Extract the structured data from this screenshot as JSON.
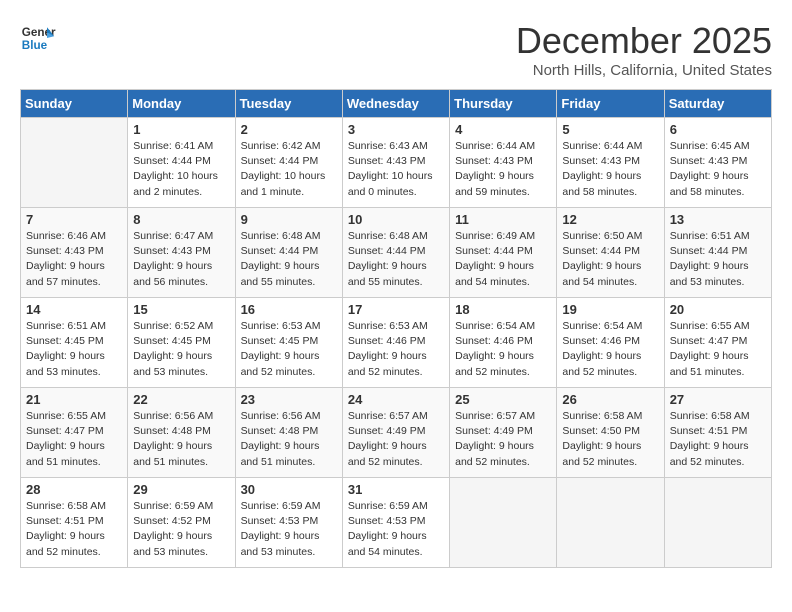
{
  "logo": {
    "line1": "General",
    "line2": "Blue"
  },
  "title": "December 2025",
  "subtitle": "North Hills, California, United States",
  "days_of_week": [
    "Sunday",
    "Monday",
    "Tuesday",
    "Wednesday",
    "Thursday",
    "Friday",
    "Saturday"
  ],
  "weeks": [
    [
      {
        "day": "",
        "info": ""
      },
      {
        "day": "1",
        "info": "Sunrise: 6:41 AM\nSunset: 4:44 PM\nDaylight: 10 hours\nand 2 minutes."
      },
      {
        "day": "2",
        "info": "Sunrise: 6:42 AM\nSunset: 4:44 PM\nDaylight: 10 hours\nand 1 minute."
      },
      {
        "day": "3",
        "info": "Sunrise: 6:43 AM\nSunset: 4:43 PM\nDaylight: 10 hours\nand 0 minutes."
      },
      {
        "day": "4",
        "info": "Sunrise: 6:44 AM\nSunset: 4:43 PM\nDaylight: 9 hours\nand 59 minutes."
      },
      {
        "day": "5",
        "info": "Sunrise: 6:44 AM\nSunset: 4:43 PM\nDaylight: 9 hours\nand 58 minutes."
      },
      {
        "day": "6",
        "info": "Sunrise: 6:45 AM\nSunset: 4:43 PM\nDaylight: 9 hours\nand 58 minutes."
      }
    ],
    [
      {
        "day": "7",
        "info": "Sunrise: 6:46 AM\nSunset: 4:43 PM\nDaylight: 9 hours\nand 57 minutes."
      },
      {
        "day": "8",
        "info": "Sunrise: 6:47 AM\nSunset: 4:43 PM\nDaylight: 9 hours\nand 56 minutes."
      },
      {
        "day": "9",
        "info": "Sunrise: 6:48 AM\nSunset: 4:44 PM\nDaylight: 9 hours\nand 55 minutes."
      },
      {
        "day": "10",
        "info": "Sunrise: 6:48 AM\nSunset: 4:44 PM\nDaylight: 9 hours\nand 55 minutes."
      },
      {
        "day": "11",
        "info": "Sunrise: 6:49 AM\nSunset: 4:44 PM\nDaylight: 9 hours\nand 54 minutes."
      },
      {
        "day": "12",
        "info": "Sunrise: 6:50 AM\nSunset: 4:44 PM\nDaylight: 9 hours\nand 54 minutes."
      },
      {
        "day": "13",
        "info": "Sunrise: 6:51 AM\nSunset: 4:44 PM\nDaylight: 9 hours\nand 53 minutes."
      }
    ],
    [
      {
        "day": "14",
        "info": "Sunrise: 6:51 AM\nSunset: 4:45 PM\nDaylight: 9 hours\nand 53 minutes."
      },
      {
        "day": "15",
        "info": "Sunrise: 6:52 AM\nSunset: 4:45 PM\nDaylight: 9 hours\nand 53 minutes."
      },
      {
        "day": "16",
        "info": "Sunrise: 6:53 AM\nSunset: 4:45 PM\nDaylight: 9 hours\nand 52 minutes."
      },
      {
        "day": "17",
        "info": "Sunrise: 6:53 AM\nSunset: 4:46 PM\nDaylight: 9 hours\nand 52 minutes."
      },
      {
        "day": "18",
        "info": "Sunrise: 6:54 AM\nSunset: 4:46 PM\nDaylight: 9 hours\nand 52 minutes."
      },
      {
        "day": "19",
        "info": "Sunrise: 6:54 AM\nSunset: 4:46 PM\nDaylight: 9 hours\nand 52 minutes."
      },
      {
        "day": "20",
        "info": "Sunrise: 6:55 AM\nSunset: 4:47 PM\nDaylight: 9 hours\nand 51 minutes."
      }
    ],
    [
      {
        "day": "21",
        "info": "Sunrise: 6:55 AM\nSunset: 4:47 PM\nDaylight: 9 hours\nand 51 minutes."
      },
      {
        "day": "22",
        "info": "Sunrise: 6:56 AM\nSunset: 4:48 PM\nDaylight: 9 hours\nand 51 minutes."
      },
      {
        "day": "23",
        "info": "Sunrise: 6:56 AM\nSunset: 4:48 PM\nDaylight: 9 hours\nand 51 minutes."
      },
      {
        "day": "24",
        "info": "Sunrise: 6:57 AM\nSunset: 4:49 PM\nDaylight: 9 hours\nand 52 minutes."
      },
      {
        "day": "25",
        "info": "Sunrise: 6:57 AM\nSunset: 4:49 PM\nDaylight: 9 hours\nand 52 minutes."
      },
      {
        "day": "26",
        "info": "Sunrise: 6:58 AM\nSunset: 4:50 PM\nDaylight: 9 hours\nand 52 minutes."
      },
      {
        "day": "27",
        "info": "Sunrise: 6:58 AM\nSunset: 4:51 PM\nDaylight: 9 hours\nand 52 minutes."
      }
    ],
    [
      {
        "day": "28",
        "info": "Sunrise: 6:58 AM\nSunset: 4:51 PM\nDaylight: 9 hours\nand 52 minutes."
      },
      {
        "day": "29",
        "info": "Sunrise: 6:59 AM\nSunset: 4:52 PM\nDaylight: 9 hours\nand 53 minutes."
      },
      {
        "day": "30",
        "info": "Sunrise: 6:59 AM\nSunset: 4:53 PM\nDaylight: 9 hours\nand 53 minutes."
      },
      {
        "day": "31",
        "info": "Sunrise: 6:59 AM\nSunset: 4:53 PM\nDaylight: 9 hours\nand 54 minutes."
      },
      {
        "day": "",
        "info": ""
      },
      {
        "day": "",
        "info": ""
      },
      {
        "day": "",
        "info": ""
      }
    ]
  ]
}
